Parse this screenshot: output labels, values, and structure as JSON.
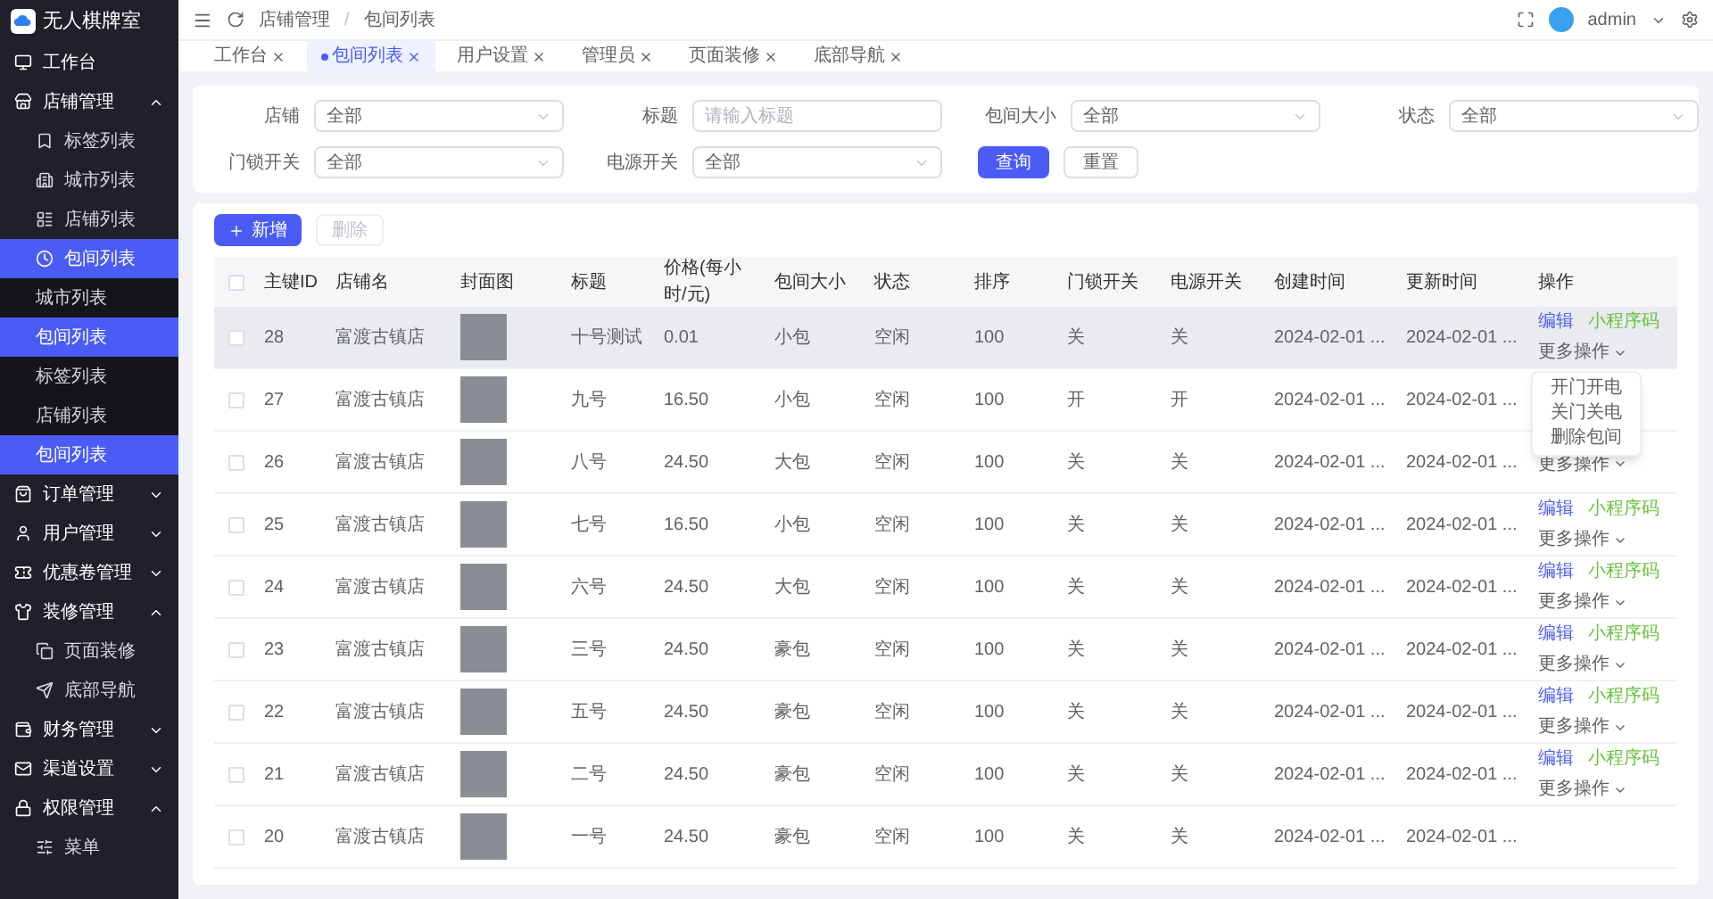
{
  "sidebar": {
    "logo_text": "无人棋牌室",
    "items": [
      {
        "label": "工作台"
      },
      {
        "label": "店铺管理",
        "expanded": true,
        "children": [
          {
            "label": "标签列表",
            "kind": "icon",
            "selected": false
          },
          {
            "label": "城市列表",
            "kind": "icon",
            "selected": false
          },
          {
            "label": "店铺列表",
            "kind": "icon",
            "selected": false
          },
          {
            "label": "包间列表",
            "kind": "icon",
            "selected": true
          },
          {
            "label": "城市列表",
            "kind": "plain",
            "selected": false
          },
          {
            "label": "包间列表",
            "kind": "plain",
            "selected": true
          },
          {
            "label": "标签列表",
            "kind": "plain",
            "selected": false
          },
          {
            "label": "店铺列表",
            "kind": "plain",
            "selected": false
          },
          {
            "label": "包间列表",
            "kind": "plain",
            "selected": true
          }
        ]
      },
      {
        "label": "订单管理",
        "expanded": false
      },
      {
        "label": "用户管理",
        "expanded": false
      },
      {
        "label": "优惠卷管理",
        "expanded": false
      },
      {
        "label": "装修管理",
        "expanded": true,
        "children": [
          {
            "label": "页面装修",
            "kind": "icon",
            "selected": false
          },
          {
            "label": "底部导航",
            "kind": "icon",
            "selected": false
          }
        ]
      },
      {
        "label": "财务管理",
        "expanded": false
      },
      {
        "label": "渠道设置",
        "expanded": false
      },
      {
        "label": "权限管理",
        "expanded": true,
        "children": [
          {
            "label": "菜单",
            "kind": "icon",
            "selected": false
          }
        ]
      }
    ]
  },
  "header": {
    "breadcrumb": [
      "店铺管理",
      "包间列表"
    ],
    "separator": "/",
    "user": "admin"
  },
  "tabs": [
    {
      "label": "工作台",
      "selected": false
    },
    {
      "label": "包间列表",
      "selected": true
    },
    {
      "label": "用户设置",
      "selected": false
    },
    {
      "label": "管理员",
      "selected": false
    },
    {
      "label": "页面装修",
      "selected": false
    },
    {
      "label": "底部导航",
      "selected": false
    }
  ],
  "filters": [
    {
      "label": "店铺",
      "kind": "select",
      "value": "全部"
    },
    {
      "label": "标题",
      "kind": "input",
      "placeholder": "请输入标题"
    },
    {
      "label": "包间大小",
      "kind": "select",
      "value": "全部"
    },
    {
      "label": "状态",
      "kind": "select",
      "value": "全部"
    },
    {
      "label": "门锁开关",
      "kind": "select",
      "value": "全部"
    },
    {
      "label": "电源开关",
      "kind": "select",
      "value": "全部"
    }
  ],
  "filter_buttons": {
    "search": "查询",
    "reset": "重置"
  },
  "toolbar": {
    "add": "新增",
    "delete": {
      "label": "删除",
      "disabled": true
    }
  },
  "table": {
    "all_checked": false,
    "columns": [
      "主键ID",
      "店铺名",
      "封面图",
      "标题",
      "价格(每小时/元)",
      "包间大小",
      "状态",
      "排序",
      "门锁开关",
      "电源开关",
      "创建时间",
      "更新时间",
      "操作"
    ],
    "rows": [
      {
        "id": "28",
        "shop": "富渡古镇店",
        "title": "十号测试",
        "price": "0.01",
        "size": "小包",
        "status": "空闲",
        "sort": "100",
        "door": "关",
        "power": "关",
        "created": "2024-02-01 ...",
        "updated": "2024-02-01 ...",
        "highlighted": true,
        "edit": "编辑",
        "qrcode": "小程序码",
        "more": "更多操作",
        "menu": [
          "开门开电",
          "关门关电",
          "删除包间"
        ]
      },
      {
        "id": "27",
        "shop": "富渡古镇店",
        "title": "九号",
        "price": "16.50",
        "size": "小包",
        "status": "空闲",
        "sort": "100",
        "door": "开",
        "power": "开",
        "created": "2024-02-01 ...",
        "updated": "2024-02-01 ...",
        "highlighted": false
      },
      {
        "id": "26",
        "shop": "富渡古镇店",
        "title": "八号",
        "price": "24.50",
        "size": "大包",
        "status": "空闲",
        "sort": "100",
        "door": "关",
        "power": "关",
        "created": "2024-02-01 ...",
        "updated": "2024-02-01 ...",
        "highlighted": false,
        "more": "更多操作"
      },
      {
        "id": "25",
        "shop": "富渡古镇店",
        "title": "七号",
        "price": "16.50",
        "size": "小包",
        "status": "空闲",
        "sort": "100",
        "door": "关",
        "power": "关",
        "created": "2024-02-01 ...",
        "updated": "2024-02-01 ...",
        "highlighted": false,
        "edit": "编辑",
        "qrcode": "小程序码",
        "more": "更多操作"
      },
      {
        "id": "24",
        "shop": "富渡古镇店",
        "title": "六号",
        "price": "24.50",
        "size": "大包",
        "status": "空闲",
        "sort": "100",
        "door": "关",
        "power": "关",
        "created": "2024-02-01 ...",
        "updated": "2024-02-01 ...",
        "highlighted": false,
        "edit": "编辑",
        "qrcode": "小程序码",
        "more": "更多操作"
      },
      {
        "id": "23",
        "shop": "富渡古镇店",
        "title": "三号",
        "price": "24.50",
        "size": "豪包",
        "status": "空闲",
        "sort": "100",
        "door": "关",
        "power": "关",
        "created": "2024-02-01 ...",
        "updated": "2024-02-01 ...",
        "highlighted": false,
        "edit": "编辑",
        "qrcode": "小程序码",
        "more": "更多操作"
      },
      {
        "id": "22",
        "shop": "富渡古镇店",
        "title": "五号",
        "price": "24.50",
        "size": "豪包",
        "status": "空闲",
        "sort": "100",
        "door": "关",
        "power": "关",
        "created": "2024-02-01 ...",
        "updated": "2024-02-01 ...",
        "highlighted": false,
        "edit": "编辑",
        "qrcode": "小程序码",
        "more": "更多操作"
      },
      {
        "id": "21",
        "shop": "富渡古镇店",
        "title": "二号",
        "price": "24.50",
        "size": "豪包",
        "status": "空闲",
        "sort": "100",
        "door": "关",
        "power": "关",
        "created": "2024-02-01 ...",
        "updated": "2024-02-01 ...",
        "highlighted": false,
        "edit": "编辑",
        "qrcode": "小程序码",
        "more": "更多操作"
      },
      {
        "id": "20",
        "shop": "富渡古镇店",
        "title": "一号",
        "price": "24.50",
        "size": "豪包",
        "status": "空闲",
        "sort": "100",
        "door": "关",
        "power": "关",
        "created": "2024-02-01 ...",
        "updated": "2024-02-01 ...",
        "highlighted": false
      }
    ]
  }
}
